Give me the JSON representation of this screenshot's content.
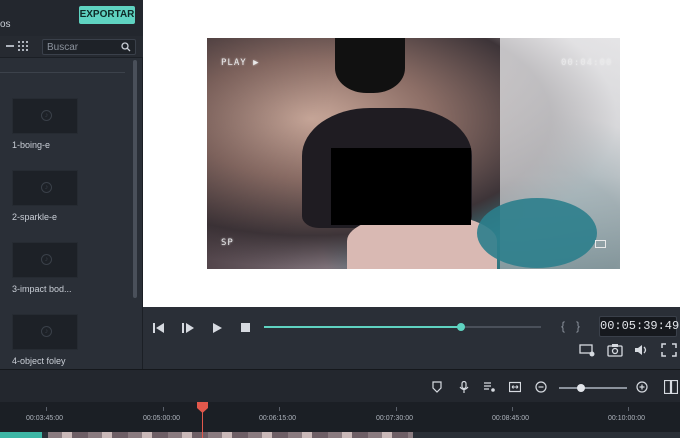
{
  "topbar": {
    "fragment_text": "os",
    "export_label": "EXPORTAR"
  },
  "left_panel": {
    "search_placeholder": "Buscar",
    "assets": [
      {
        "label": "1-boing-e"
      },
      {
        "label": "2-sparkle-e"
      },
      {
        "label": "3-impact bod..."
      },
      {
        "label": "4-object foley"
      }
    ]
  },
  "preview": {
    "osd_play": "PLAY ▶",
    "osd_time": "00:04:00",
    "osd_sp": "SP"
  },
  "transport": {
    "timecode": "00:05:39:49",
    "progress": 0.71,
    "brace_open": "{",
    "brace_close": "}"
  },
  "timeline": {
    "zoom_level": 0.33,
    "ruler_labels": [
      "00:03:45:00",
      "00:05:00:00",
      "00:06:15:00",
      "00:07:30:00",
      "00:08:45:00",
      "00:10:00:00"
    ]
  },
  "colors": {
    "accent": "#5fd3c1",
    "playhead": "#e2584c"
  }
}
